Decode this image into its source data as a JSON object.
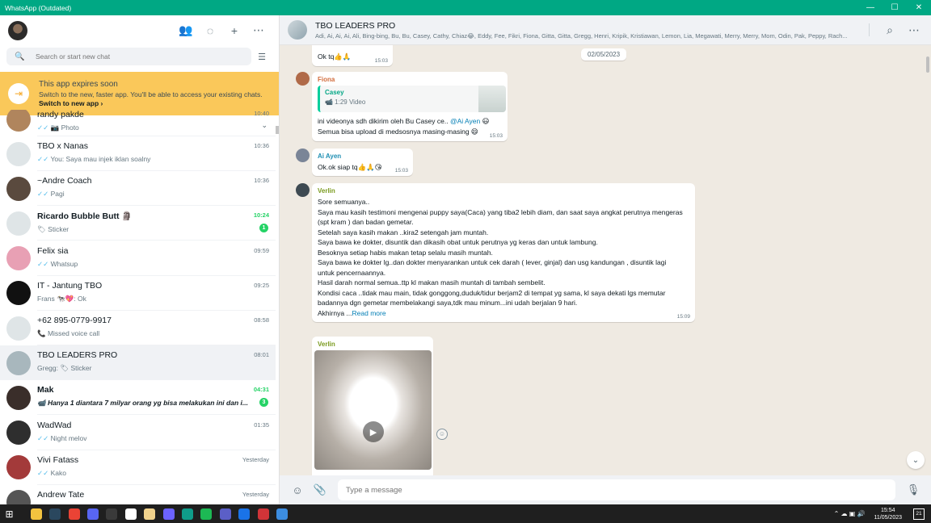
{
  "window": {
    "title": "WhatsApp (Outdated)",
    "minimize": "—",
    "maximize": "☐",
    "close": "✕"
  },
  "left_header": {
    "icons": {
      "community": "👥",
      "status": "◌",
      "new_chat": "+",
      "menu": "⋯"
    }
  },
  "search": {
    "placeholder": "Search or start new chat",
    "icon": "🔍",
    "filter_icon": "☰"
  },
  "banner": {
    "title": "This app expires soon",
    "line1": "Switch to the new, faster app. You'll be able to access your existing chats.",
    "link": "Switch to new app ›",
    "icon": "⇥"
  },
  "chats": [
    {
      "name": "randy pakde",
      "time": "10:40",
      "preview": "📷 Photo",
      "tick": "✓✓",
      "avatar_color": "#b0855d",
      "chevron": "⌄"
    },
    {
      "name": "TBO x Nanas",
      "time": "10:36",
      "preview": "You: Saya mau injek iklan soalny",
      "tick": "✓✓",
      "avatar_color": "#dfe5e7"
    },
    {
      "name": "~Andre Coach",
      "time": "10:36",
      "preview": "Pagi",
      "tick": "✓✓",
      "avatar_color": "#5a4a3e"
    },
    {
      "name": "Ricardo Bubble Butt 🗿",
      "time": "10:24",
      "preview": "🏷 Sticker",
      "badge": "1",
      "avatar_color": "#dfe5e7",
      "bold": true
    },
    {
      "name": "Felix sia",
      "time": "09:59",
      "preview": "Whatsup",
      "tick": "✓✓",
      "avatar_color": "#e8a0b4"
    },
    {
      "name": "IT - Jantung TBO",
      "time": "09:25",
      "preview": "Frans 🐄💖: Ok",
      "avatar_color": "#111111"
    },
    {
      "name": "+62 895-0779-9917",
      "time": "08:58",
      "preview": "📞 Missed voice call",
      "avatar_color": "#dfe5e7"
    },
    {
      "name": "TBO LEADERS PRO",
      "time": "08:01",
      "preview": "Gregg: 🏷 Sticker",
      "avatar_color": "#a8b7bd",
      "active": true
    },
    {
      "name": "Mak",
      "time": "04:31",
      "preview": "📹 Hanya 1 diantara 7 milyar orang yg bisa melakukan ini dan i...",
      "badge": "3",
      "avatar_color": "#3a2e2a",
      "bold": true,
      "preview_bold": true
    },
    {
      "name": "WadWad",
      "time": "01:35",
      "preview": "Night melov",
      "tick": "✓✓",
      "avatar_color": "#2e2e2e"
    },
    {
      "name": "Vivi Fatass",
      "time": "Yesterday",
      "preview": "Kako",
      "tick": "✓✓",
      "avatar_color": "#a33a3a"
    },
    {
      "name": "Andrew Tate",
      "time": "Yesterday",
      "preview": "",
      "avatar_color": "#555555"
    }
  ],
  "chat_header": {
    "name": "TBO LEADERS PRO",
    "members": "Adi, Ai, Ai, Ai, Ali, Bing-bing, Bu, Bu, Casey, Cathy, Chiaz😂, Eddy, Fee, Fikri, Fiona, Gitta, Gitta, Gregg, Henri, Kripik, Kristiawan, Lemon, Lia, Megawati, Merry, Merry, Mom, Odin, Pak, Peppy, Rach...",
    "search_icon": "⌕",
    "menu_icon": "⋯"
  },
  "messages": {
    "date": "02/05/2023",
    "m0": {
      "text": "Ok tq👍🙏",
      "time": "15:03"
    },
    "m1": {
      "sender": "Fiona",
      "sender_color": "#d26c3c",
      "quote_name": "Casey",
      "quote_sub": "📹 1:29 Video",
      "line1": "ini videonya sdh dikirim oleh Bu Casey ce.. ",
      "mention": "@Ai Ayen",
      "line1_end": " 😃",
      "line2": "Semua bisa upload di medsosnya masing-masing 😄",
      "time": "15:03"
    },
    "m2": {
      "sender": "Ai Ayen",
      "sender_color": "#1f8fb3",
      "text": "Ok.ok siap tq👍🙏😘",
      "time": "15:03"
    },
    "m3": {
      "sender": "Verlin",
      "sender_color": "#7a9a1e",
      "lines": [
        "Sore semuanya..",
        "Saya mau kasih testimoni mengenai puppy saya(Caca) yang tiba2 lebih diam, dan saat saya angkat perutnya mengeras",
        "(spt kram ) dan badan gemetar.",
        "Setelah saya kasih makan ..kira2 setengah jam muntah.",
        "Saya bawa ke dokter, disuntik dan dikasih obat untuk perutnya yg keras dan untuk lambung.",
        "Besoknya setiap habis makan tetap selalu masih muntah.",
        "Saya bawa ke dokter lg..dan dokter menyarankan untuk cek darah ( lever, ginjal) dan usg kandungan , disuntik lagi",
        "untuk pencernaannya.",
        "Hasil darah normal semua..ttp kl makan masih muntah di tambah sembelit.",
        "Kondisi caca ..tidak mau main, tidak gonggong,duduk/tidur berjam2 di tempat yg sama, kl saya dekati lgs memutar",
        "badannya dgn gemetar membelakangi saya,tdk mau minum...ini udah berjalan 9 hari."
      ],
      "last_line": "Akhirnya ...",
      "read_more": "Read more",
      "time": "15:09",
      "reaction": "👍"
    },
    "m4": {
      "sender": "Verlin",
      "sender_color": "#7a9a1e",
      "play": "▶"
    }
  },
  "composer": {
    "placeholder": "Type a message",
    "emoji_icon": "☺",
    "attach_icon": "📎",
    "mic_icon": "🎙"
  },
  "scroll_down_icon": "⌄",
  "taskbar": {
    "start_icon": "⊞",
    "apps": [
      {
        "name": "file-explorer",
        "color": "#f3c33f"
      },
      {
        "name": "steam",
        "color": "#2a475e"
      },
      {
        "name": "chrome",
        "color": "#ea4335"
      },
      {
        "name": "discord",
        "color": "#5865f2"
      },
      {
        "name": "media",
        "color": "#3a3a3a"
      },
      {
        "name": "notepad",
        "color": "#ffffff"
      },
      {
        "name": "photos",
        "color": "#f0d28c"
      },
      {
        "name": "video",
        "color": "#6c63ff"
      },
      {
        "name": "edge",
        "color": "#0f9d8a"
      },
      {
        "name": "spotify",
        "color": "#1db954"
      },
      {
        "name": "teams",
        "color": "#5b5fc7"
      },
      {
        "name": "browser",
        "color": "#1a73e8"
      },
      {
        "name": "whatsapp",
        "color": "#d13438"
      },
      {
        "name": "mail",
        "color": "#3c8de0"
      }
    ],
    "tray_icons": "⌃ ☁ ▣ 🔊",
    "time": "15:54",
    "date": "11/05/2023",
    "notification_count": "21"
  }
}
